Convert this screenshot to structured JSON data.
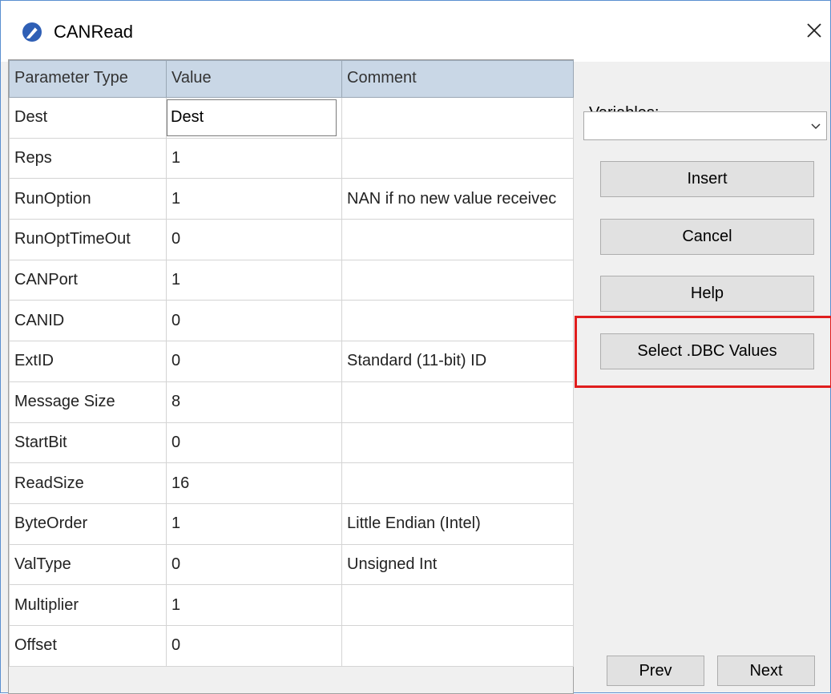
{
  "window": {
    "title": "CANRead",
    "close_icon": "close-icon",
    "app_icon": "pencil-ball-icon",
    "accent": "#5a8fd0"
  },
  "table": {
    "headers": [
      "Parameter Type",
      "Value",
      "Comment"
    ],
    "rows": [
      {
        "param": "Dest",
        "value": "Dest",
        "comment": ""
      },
      {
        "param": "Reps",
        "value": "1",
        "comment": ""
      },
      {
        "param": "RunOption",
        "value": "1",
        "comment": "NAN if no new value receivec"
      },
      {
        "param": "RunOptTimeOut",
        "value": "0",
        "comment": ""
      },
      {
        "param": "CANPort",
        "value": "1",
        "comment": ""
      },
      {
        "param": "CANID",
        "value": "0",
        "comment": ""
      },
      {
        "param": "ExtID",
        "value": "0",
        "comment": "Standard (11-bit) ID"
      },
      {
        "param": "Message Size",
        "value": "8",
        "comment": ""
      },
      {
        "param": "StartBit",
        "value": "0",
        "comment": ""
      },
      {
        "param": "ReadSize",
        "value": "16",
        "comment": ""
      },
      {
        "param": "ByteOrder",
        "value": "1",
        "comment": "Little Endian (Intel)"
      },
      {
        "param": "ValType",
        "value": "0",
        "comment": "Unsigned Int"
      },
      {
        "param": "Multiplier",
        "value": "1",
        "comment": ""
      },
      {
        "param": "Offset",
        "value": "0",
        "comment": ""
      }
    ]
  },
  "panel": {
    "variables_label": "Variables:",
    "variables_value": "",
    "insert_label": "Insert",
    "cancel_label": "Cancel",
    "help_label": "Help",
    "select_dbc_label": "Select .DBC Values",
    "prev_label": "Prev",
    "next_label": "Next",
    "highlight_color": "#e01d1d"
  }
}
